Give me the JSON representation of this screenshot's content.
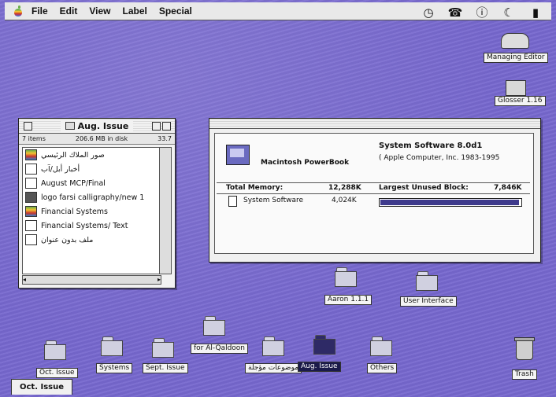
{
  "menubar": {
    "items": [
      "File",
      "Edit",
      "View",
      "Label",
      "Special"
    ],
    "right_icons": [
      "clock-icon",
      "control-strip-icon",
      "balloon-help-icon",
      "application-menu-icon",
      "finder-app-icon"
    ]
  },
  "desktop_icons": {
    "managing_editor": "Managing Editor",
    "glosser": "Glosser 1.16",
    "aaron": "Aaron 1.1.1",
    "user_interface": "User Interface",
    "oct_issue": "Oct. Issue",
    "systems": "Systems",
    "sept_issue": "Sept. Issue",
    "for_aldon": "for Al-Qaldoon",
    "arabic_folder": "موضوعات مؤجلة",
    "aug_issue": "Aug. Issue",
    "others": "Others",
    "trash": "Trash"
  },
  "finder_window": {
    "title": "Aug. Issue",
    "info_items": "7 items",
    "info_disk": "206.6 MB in disk",
    "info_avail": "33.7",
    "items": [
      {
        "name": "صور الملاك الرئيسي",
        "icon": "multi"
      },
      {
        "name": "أخبار أبل/آب",
        "icon": "doc"
      },
      {
        "name": "August MCP/Final",
        "icon": "doc"
      },
      {
        "name": "logo farsi calligraphy/new 1",
        "icon": "app"
      },
      {
        "name": "Financial Systems",
        "icon": "multi"
      },
      {
        "name": "Financial Systems/ Text",
        "icon": "doc"
      },
      {
        "name": "ملف بدون عنوان",
        "icon": "doc"
      }
    ]
  },
  "about_window": {
    "computer_name": "Macintosh PowerBook",
    "system_version": "System Software 8.0d1",
    "copyright": "( Apple Computer, Inc. 1983-1995",
    "total_memory_label": "Total Memory:",
    "total_memory_value": "12,288K",
    "largest_block_label": "Largest Unused Block:",
    "largest_block_value": "7,846K",
    "process_name": "System Software",
    "process_memory": "4,024K",
    "process_usage_fraction": 0.98
  },
  "bottom_tab": {
    "label": "Oct. Issue"
  }
}
